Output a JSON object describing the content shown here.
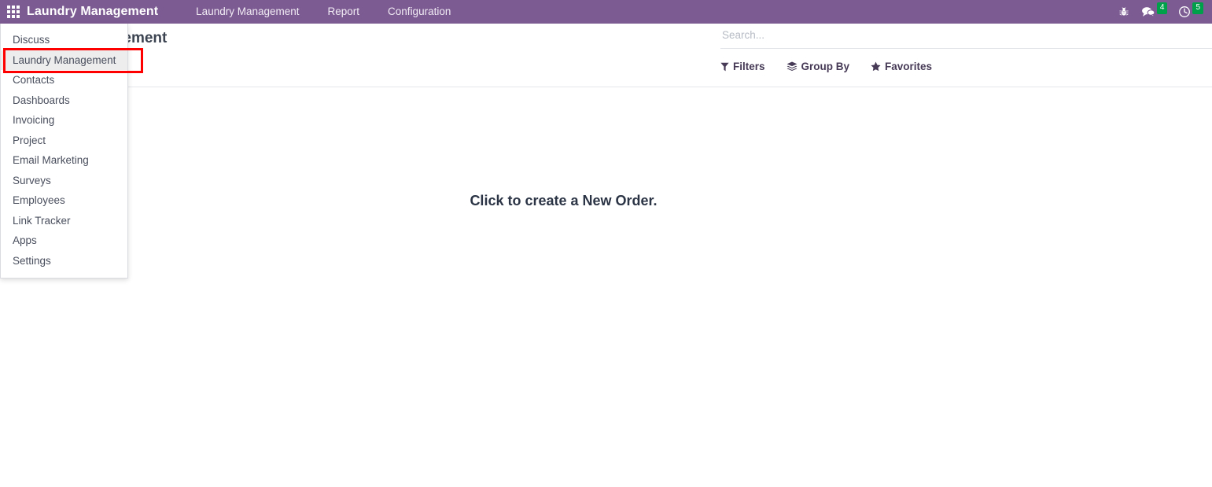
{
  "navbar": {
    "apps_toggle_name": "apps-grid-icon",
    "brand": "Laundry Management",
    "menu_items": [
      {
        "label": "Laundry Management"
      },
      {
        "label": "Report"
      },
      {
        "label": "Configuration"
      }
    ],
    "systray": [
      {
        "name": "debug-bug-icon",
        "badge": ""
      },
      {
        "name": "messaging-chat-icon",
        "badge": "4"
      },
      {
        "name": "activities-clock-icon",
        "badge": "5"
      }
    ],
    "background_color": "#7c5a92"
  },
  "control_panel": {
    "title": "Laundry Management",
    "search": {
      "placeholder": "Search...",
      "value": ""
    },
    "facets": [
      {
        "label": "Filters",
        "icon": "filter-funnel-icon"
      },
      {
        "label": "Group By",
        "icon": "layers-stack-icon"
      },
      {
        "label": "Favorites",
        "icon": "star-icon"
      }
    ]
  },
  "main": {
    "empty_state_message": "Click to create a New Order."
  },
  "apps_menu": {
    "active_item": "Laundry Management",
    "highlight_color": "#fe0000",
    "items": [
      {
        "label": "Discuss"
      },
      {
        "label": "Laundry Management"
      },
      {
        "label": "Contacts"
      },
      {
        "label": "Dashboards"
      },
      {
        "label": "Invoicing"
      },
      {
        "label": "Project"
      },
      {
        "label": "Email Marketing"
      },
      {
        "label": "Surveys"
      },
      {
        "label": "Employees"
      },
      {
        "label": "Link Tracker"
      },
      {
        "label": "Apps"
      },
      {
        "label": "Settings"
      }
    ]
  }
}
